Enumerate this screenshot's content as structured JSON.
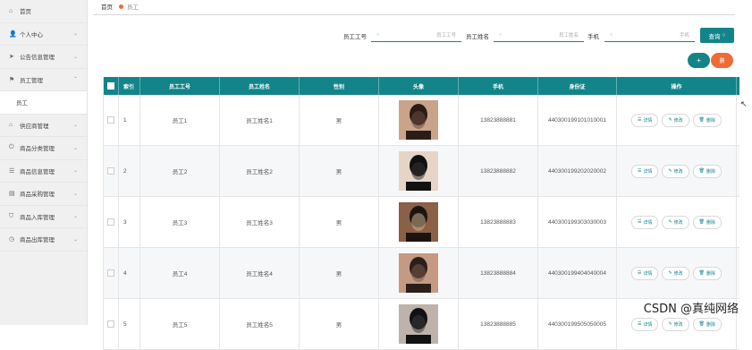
{
  "sidebar": {
    "items": [
      {
        "label": "首页",
        "icon": "home-icon",
        "glyph": "⌂",
        "chev": ""
      },
      {
        "label": "个人中心",
        "icon": "user-icon",
        "glyph": "👤",
        "chev": "⌄"
      },
      {
        "label": "公告信息管理",
        "icon": "send-icon",
        "glyph": "➤",
        "chev": "⌄"
      },
      {
        "label": "员工管理",
        "icon": "flag-icon",
        "glyph": "⚑",
        "chev": "⌃"
      },
      {
        "label": "员工",
        "icon": "",
        "glyph": "",
        "chev": "",
        "sub": true
      },
      {
        "label": "供应商管理",
        "icon": "bank-icon",
        "glyph": "⌂",
        "chev": "⌄"
      },
      {
        "label": "商品分类管理",
        "icon": "power-icon",
        "glyph": "⏻",
        "chev": "⌄"
      },
      {
        "label": "商品信息管理",
        "icon": "list-icon",
        "glyph": "☰",
        "chev": "⌄"
      },
      {
        "label": "商品采购管理",
        "icon": "box-icon",
        "glyph": "▤",
        "chev": "⌄"
      },
      {
        "label": "商品入库管理",
        "icon": "shield-icon",
        "glyph": "⛉",
        "chev": "⌄"
      },
      {
        "label": "商品出库管理",
        "icon": "clock-icon",
        "glyph": "◷",
        "chev": "⌄"
      }
    ]
  },
  "breadcrumb": {
    "home": "首页",
    "current": "员工"
  },
  "search": {
    "emp_no_label": "员工工号",
    "emp_no_placeholder": "员工工号",
    "emp_name_label": "员工姓名",
    "emp_name_placeholder": "员工姓名",
    "phone_label": "手机",
    "phone_placeholder": "手机",
    "query_label": "查询"
  },
  "actions": {
    "add": "+",
    "delete": "删"
  },
  "table": {
    "headers": [
      "索引",
      "员工工号",
      "员工姓名",
      "性别",
      "头像",
      "手机",
      "身份证",
      "操作"
    ],
    "rows": [
      {
        "idx": "1",
        "no": "员工1",
        "name": "员工姓名1",
        "gender": "男",
        "phone": "13823888881",
        "id": "440300199101010001"
      },
      {
        "idx": "2",
        "no": "员工2",
        "name": "员工姓名2",
        "gender": "男",
        "phone": "13823888882",
        "id": "440300199202020002"
      },
      {
        "idx": "3",
        "no": "员工3",
        "name": "员工姓名3",
        "gender": "男",
        "phone": "13823888883",
        "id": "440300199303030003"
      },
      {
        "idx": "4",
        "no": "员工4",
        "name": "员工姓名4",
        "gender": "男",
        "phone": "13823888884",
        "id": "440300199404040004"
      },
      {
        "idx": "5",
        "no": "员工5",
        "name": "员工姓名5",
        "gender": "男",
        "phone": "13823888885",
        "id": "440300199505050005"
      }
    ],
    "ops": {
      "detail": "详情",
      "edit": "修改",
      "delete": "删除"
    }
  },
  "watermark": "CSDN @真纯网络",
  "colors": {
    "primary": "#13858a",
    "accent": "#f06a35"
  }
}
